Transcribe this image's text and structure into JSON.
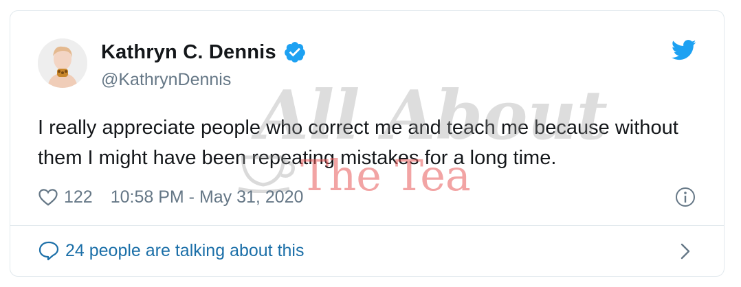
{
  "tweet": {
    "author_name": "Kathryn C. Dennis",
    "handle": "@KathrynDennis",
    "text": "I really appreciate people who correct me and teach me because without them I might have been repeating mistakes for a long time.",
    "likes": "122",
    "timestamp": "10:58 PM - May 31, 2020",
    "talking_link": "24 people are talking about this"
  },
  "watermark": {
    "line1": "All About",
    "line2": "The Tea"
  },
  "icons": {
    "verified": "verified-badge-icon",
    "brand": "twitter-bird-icon",
    "like": "heart-icon",
    "info": "info-icon",
    "comment": "comment-bubble-icon",
    "chevron": "chevron-right-icon"
  },
  "colors": {
    "twitter_blue": "#1da1f2",
    "link_blue": "#1b6fa8",
    "text_primary": "#14171a",
    "text_secondary": "#657786",
    "border": "#e1e8ed"
  }
}
